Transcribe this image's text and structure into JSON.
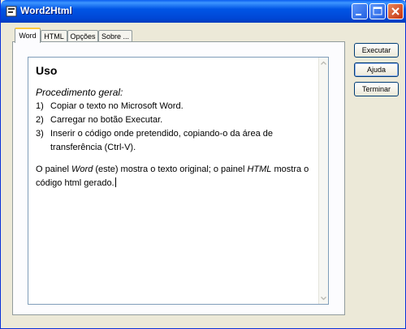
{
  "window": {
    "title": "Word2Html"
  },
  "tabs": [
    {
      "label": "Word",
      "active": true
    },
    {
      "label": "HTML",
      "active": false
    },
    {
      "label": "Opções",
      "active": false
    },
    {
      "label": "Sobre ...",
      "active": false
    }
  ],
  "buttons": {
    "execute": "Executar",
    "help": "Ajuda",
    "exit": "Terminar"
  },
  "document": {
    "heading": "Uso",
    "subheading": "Procedimento geral:",
    "steps": [
      {
        "num": "1)",
        "text": "Copiar o texto no Microsoft Word."
      },
      {
        "num": "2)",
        "text": "Carregar no botão Executar."
      },
      {
        "num": "3)",
        "text": "Inserir o código onde pretendido, copiando-o da área de transferência (Ctrl-V)."
      }
    ],
    "paragraph": {
      "p1": "O painel ",
      "em1": "Word",
      "p2": " (este) mostra o texto original; o painel ",
      "em2": "HTML",
      "p3": " mostra o código html gerado."
    }
  },
  "colors": {
    "titlebar": "#0055e5",
    "close": "#c4330f",
    "face": "#ece9d8",
    "tab_highlight": "#ffc83c"
  }
}
